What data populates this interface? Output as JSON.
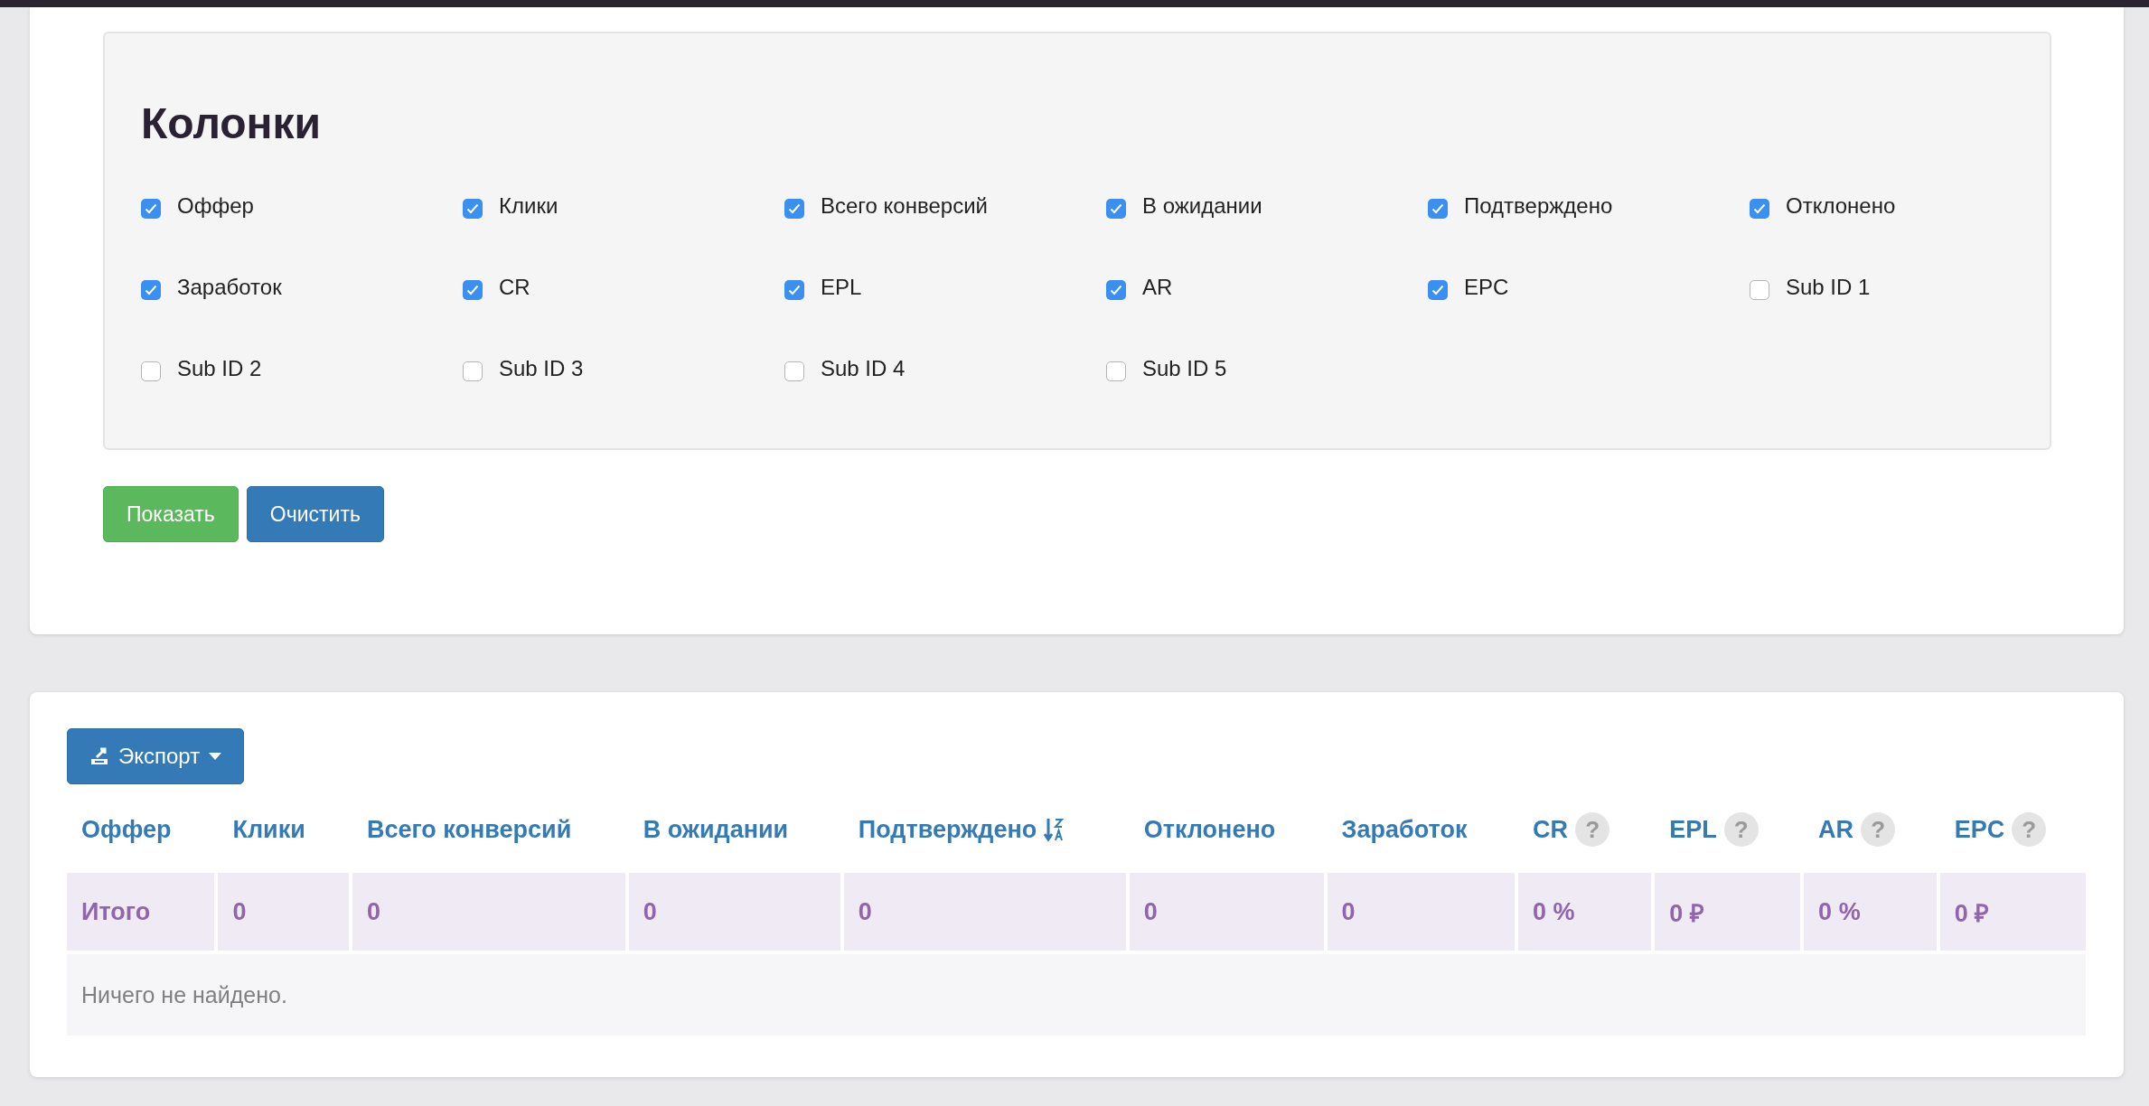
{
  "columns_panel": {
    "title": "Колонки",
    "options": [
      {
        "label": "Оффер",
        "checked": true
      },
      {
        "label": "Клики",
        "checked": true
      },
      {
        "label": "Всего конверсий",
        "checked": true
      },
      {
        "label": "В ожидании",
        "checked": true
      },
      {
        "label": "Подтверждено",
        "checked": true
      },
      {
        "label": "Отклонено",
        "checked": true
      },
      {
        "label": "Заработок",
        "checked": true
      },
      {
        "label": "CR",
        "checked": true
      },
      {
        "label": "EPL",
        "checked": true
      },
      {
        "label": "AR",
        "checked": true
      },
      {
        "label": "EPC",
        "checked": true
      },
      {
        "label": "Sub ID 1",
        "checked": false
      },
      {
        "label": "Sub ID 2",
        "checked": false
      },
      {
        "label": "Sub ID 3",
        "checked": false
      },
      {
        "label": "Sub ID 4",
        "checked": false
      },
      {
        "label": "Sub ID 5",
        "checked": false
      }
    ]
  },
  "buttons": [
    {
      "label": "Показать",
      "kind": "success"
    },
    {
      "label": "Очистить",
      "kind": "primary"
    }
  ],
  "export_button": {
    "label": "Экспорт"
  },
  "table": {
    "columns": [
      {
        "label": "Оффер",
        "sorted": false
      },
      {
        "label": "Клики",
        "sorted": false
      },
      {
        "label": "Всего конверсий",
        "sorted": false
      },
      {
        "label": "В ожидании",
        "sorted": false
      },
      {
        "label": "Подтверждено",
        "sorted": true
      },
      {
        "label": "Отклонено",
        "sorted": false
      },
      {
        "label": "Заработок",
        "sorted": false
      },
      {
        "label": "CR",
        "sorted": false,
        "help": "?"
      },
      {
        "label": "EPL",
        "sorted": false,
        "help": "?"
      },
      {
        "label": "AR",
        "sorted": false,
        "help": "?"
      },
      {
        "label": "EPC",
        "sorted": false,
        "help": "?"
      }
    ],
    "total_row": [
      "Итого",
      "0",
      "0",
      "0",
      "0",
      "0",
      "0",
      "0 %",
      "0 ₽",
      "0 %",
      "0 ₽"
    ],
    "empty_message": "Ничего не найдено."
  }
}
